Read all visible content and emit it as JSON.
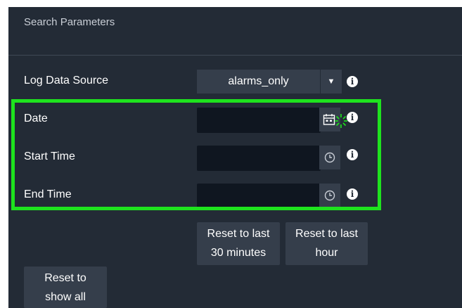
{
  "panel": {
    "title": "Search Parameters"
  },
  "fields": {
    "log_data_source": {
      "label": "Log Data Source",
      "value": "alarms_only"
    },
    "date": {
      "label": "Date",
      "value": ""
    },
    "start_time": {
      "label": "Start Time",
      "value": ""
    },
    "end_time": {
      "label": "End Time",
      "value": ""
    }
  },
  "buttons": {
    "reset_30": [
      "Reset to last",
      "30 minutes"
    ],
    "reset_hour": [
      "Reset to last",
      "hour"
    ],
    "reset_all": [
      "Reset to",
      "show all"
    ]
  },
  "icons": {
    "info": "info-icon",
    "calendar": "calendar-icon",
    "clock": "clock-icon",
    "dropdown": "dropdown-arrow-icon",
    "cursor": "click-cursor-icon"
  },
  "colors": {
    "panel_bg": "#232b36",
    "field_bg": "#0f1620",
    "button_bg": "#353e4b",
    "highlight": "#1ee31e"
  }
}
